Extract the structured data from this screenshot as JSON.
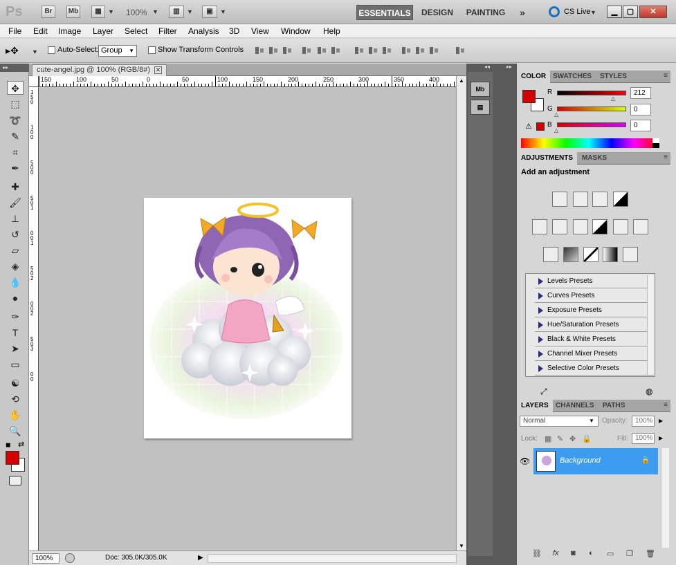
{
  "app": {
    "logo": "Ps",
    "bridge_btn": "Br",
    "minibridge_btn": "Mb",
    "zoom": "100%",
    "workspaces": [
      "ESSENTIALS",
      "DESIGN",
      "PAINTING"
    ],
    "more_workspaces": "»",
    "cs_live": "CS Live"
  },
  "menus": [
    "File",
    "Edit",
    "Image",
    "Layer",
    "Select",
    "Filter",
    "Analysis",
    "3D",
    "View",
    "Window",
    "Help"
  ],
  "options": {
    "auto_select_label": "Auto-Select:",
    "auto_select_value": "Group",
    "transform_label": "Show Transform Controls"
  },
  "document": {
    "tab_title": "cute-angel.jpg @ 100% (RGB/8#)",
    "ruler_labels": [
      "150",
      "100",
      "50",
      "0",
      "50",
      "100",
      "150",
      "200",
      "250",
      "300",
      "350",
      "400"
    ],
    "vruler_labels": [
      "1",
      "5",
      "0",
      "1",
      "0",
      "0",
      "5",
      "0",
      "0",
      "5",
      "0",
      "1",
      "0",
      "0",
      "1",
      "5",
      "0",
      "2",
      "0",
      "0",
      "2",
      "5",
      "0",
      "3",
      "0",
      "0"
    ],
    "zoom": "100%",
    "doc_info": "Doc: 305.0K/305.0K"
  },
  "color_panel": {
    "tabs": [
      "COLOR",
      "SWATCHES",
      "STYLES"
    ],
    "r_label": "R",
    "g_label": "G",
    "b_label": "B",
    "r": "212",
    "g": "0",
    "b": "0",
    "foreground": "#d40000",
    "background": "#ffffff"
  },
  "adjustments_panel": {
    "tabs": [
      "ADJUSTMENTS",
      "MASKS"
    ],
    "title": "Add an adjustment",
    "presets": [
      "Levels Presets",
      "Curves Presets",
      "Exposure Presets",
      "Hue/Saturation Presets",
      "Black & White Presets",
      "Channel Mixer Presets",
      "Selective Color Presets"
    ]
  },
  "layers_panel": {
    "tabs": [
      "LAYERS",
      "CHANNELS",
      "PATHS"
    ],
    "blend_mode": "Normal",
    "opacity_label": "Opacity:",
    "opacity": "100%",
    "lock_label": "Lock:",
    "fill_label": "Fill:",
    "fill": "100%",
    "layers": [
      {
        "name": "Background"
      }
    ]
  }
}
